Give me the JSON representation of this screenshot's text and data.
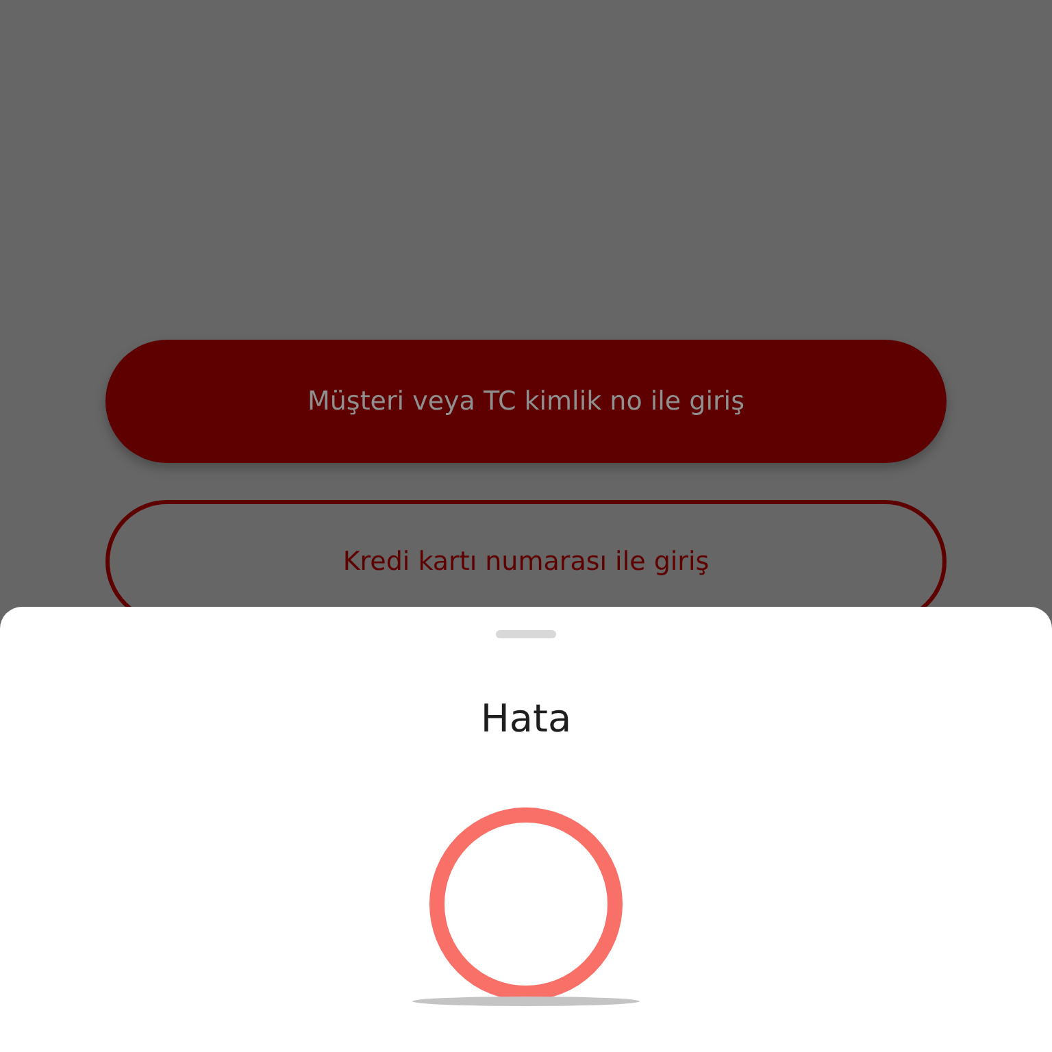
{
  "login_options": [
    {
      "label": "Müşteri veya TC kimlik no ile giriş",
      "kind": "filled"
    },
    {
      "label": "Kredi kartı numarası ile giriş",
      "kind": "outlined"
    }
  ],
  "sheet": {
    "title": "Hata"
  }
}
